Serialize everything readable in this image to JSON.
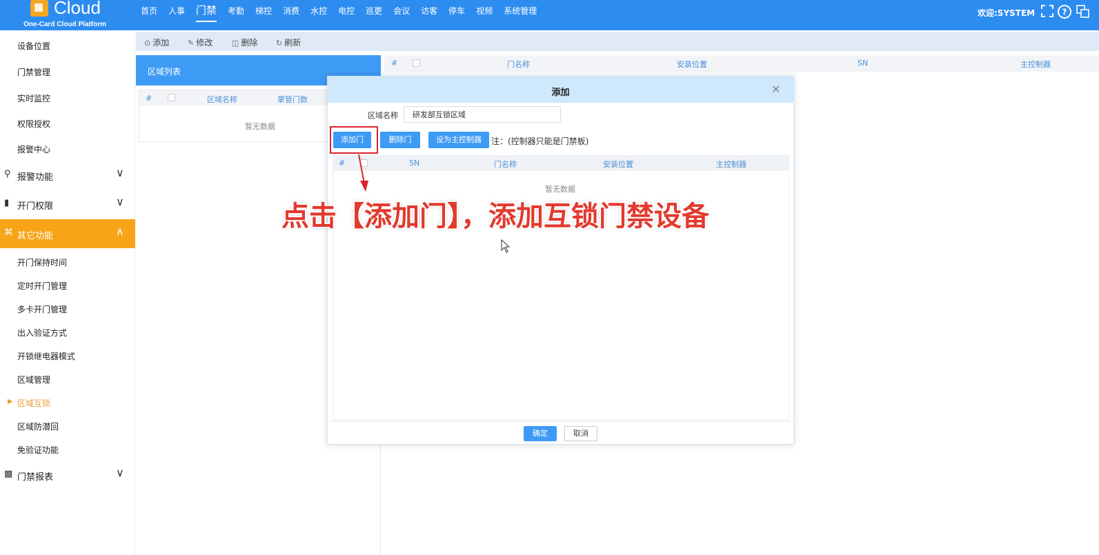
{
  "brand": {
    "name": "Cloud",
    "subtitle": "One-Card Cloud Platform"
  },
  "nav": {
    "items": [
      "首页",
      "人事",
      "门禁",
      "考勤",
      "梯控",
      "消费",
      "水控",
      "电控",
      "巡更",
      "会议",
      "访客",
      "停车",
      "视频",
      "系统管理"
    ],
    "active_index": 2
  },
  "header": {
    "welcome": "欢迎:SYSTEM",
    "icons": [
      "fullscreen-icon",
      "help-icon",
      "language-icon"
    ]
  },
  "sidebar": {
    "top_items": [
      "设备位置",
      "门禁管理",
      "实时监控",
      "权限授权",
      "报警中心"
    ],
    "groups": {
      "alarm": "报警功能",
      "door_perm": "开门权限",
      "other": "其它功能",
      "report": "门禁报表"
    },
    "other_items": [
      "开门保持时间",
      "定时开门管理",
      "多卡开门管理",
      "出入验证方式",
      "开锁继电器模式",
      "区域管理",
      "区域互锁",
      "区域防潜回",
      "免验证功能"
    ],
    "current_item": "区域互锁"
  },
  "toolbar": {
    "add": "添加",
    "edit": "修改",
    "delete": "删除",
    "refresh": "刷新"
  },
  "region_panel": {
    "title": "区域列表",
    "columns": [
      "#",
      "区域名称",
      "掌管门数"
    ],
    "empty": "暂无数据"
  },
  "door_panel": {
    "columns": [
      "#",
      "门名称",
      "安装位置",
      "SN",
      "主控制器"
    ]
  },
  "modal": {
    "title": "添加",
    "field_label": "区域名称",
    "field_value": "研发部互锁区域",
    "buttons": {
      "add_door": "添加门",
      "delete_door": "删除门",
      "set_master": "设为主控制器"
    },
    "note": "注：(控制器只能是门禁板)",
    "columns": [
      "#",
      "SN",
      "门名称",
      "安装位置",
      "主控制器"
    ],
    "empty": "暂无数据",
    "ok": "确定",
    "cancel": "取消"
  },
  "annotation": {
    "text": "点击【添加门】，添加互锁门禁设备",
    "color": "#e23a2e"
  },
  "colors": {
    "primary": "#2d8cf0",
    "accent": "#f7a416",
    "highlight": "#d9242b"
  }
}
